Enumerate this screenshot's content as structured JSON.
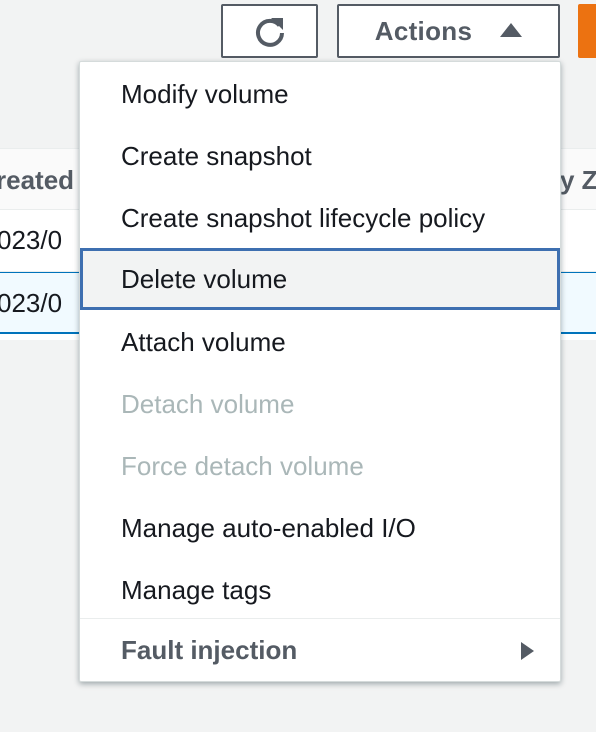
{
  "toolbar": {
    "refresh_icon": "refresh-icon",
    "actions_label": "Actions",
    "actions_icon": "caret-up-icon",
    "primary_color": "#ec7211"
  },
  "table": {
    "columns": [
      "reated",
      "y Z"
    ],
    "rows": [
      {
        "created": "023/0",
        "selected": false
      },
      {
        "created": "023/0",
        "selected": true
      }
    ]
  },
  "menu": {
    "items": [
      {
        "label": "Modify volume",
        "enabled": true
      },
      {
        "label": "Create snapshot",
        "enabled": true
      },
      {
        "label": "Create snapshot lifecycle policy",
        "enabled": true
      },
      {
        "label": "Delete volume",
        "enabled": true,
        "highlighted": true
      },
      {
        "label": "Attach volume",
        "enabled": true
      },
      {
        "label": "Detach volume",
        "enabled": false
      },
      {
        "label": "Force detach volume",
        "enabled": false
      },
      {
        "label": "Manage auto-enabled I/O",
        "enabled": true
      },
      {
        "label": "Manage tags",
        "enabled": true
      }
    ],
    "group": {
      "label": "Fault injection",
      "icon": "caret-right-icon"
    }
  },
  "colors": {
    "focus_border": "#3e6fb0",
    "disabled_text": "#aab7b8",
    "selected_row_border": "#0073bb"
  }
}
